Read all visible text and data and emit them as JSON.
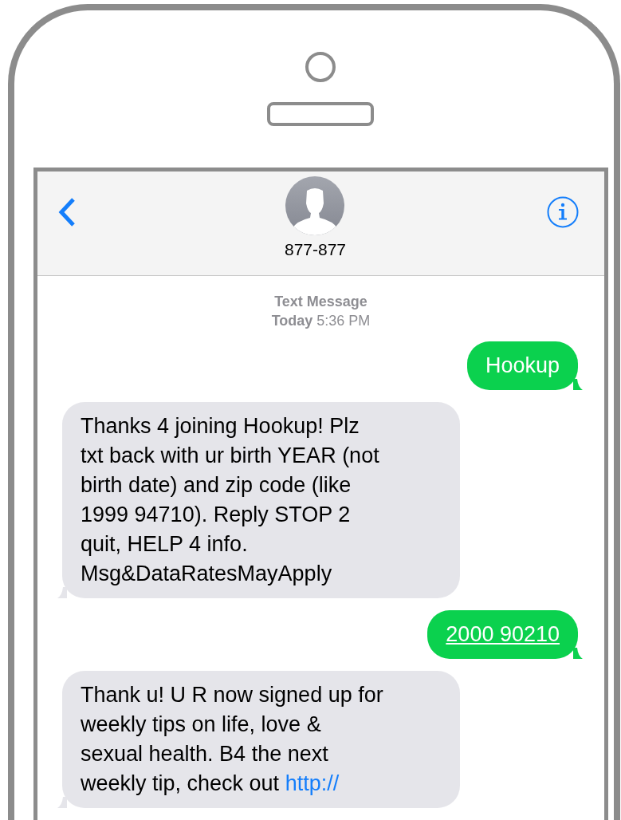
{
  "header": {
    "contact": "877-877"
  },
  "timestamp": {
    "label": "Text Message",
    "time": "**Today** 5:36 PM"
  },
  "messages": [
    {
      "kind": "sent",
      "lines": [
        "Hookup"
      ],
      "underlined": false
    },
    {
      "kind": "received",
      "lines": [
        "Thanks 4 joining Hookup! Plz",
        "txt back with ur birth YEAR (not",
        "birth date) and zip code (like",
        "1999 94710). Reply STOP 2",
        "quit, HELP 4 info.",
        "Msg&DataRatesMayApply"
      ],
      "underlined": false
    },
    {
      "kind": "sent",
      "lines": [
        "2000 90210"
      ],
      "underlined": true
    },
    {
      "kind": "received",
      "lines": [
        "Thank u! U R now signed up for",
        "weekly tips on life, love &",
        "sexual health. B4 the next",
        "weekly tip, check out "
      ],
      "link": "http://",
      "underlined": false
    }
  ]
}
